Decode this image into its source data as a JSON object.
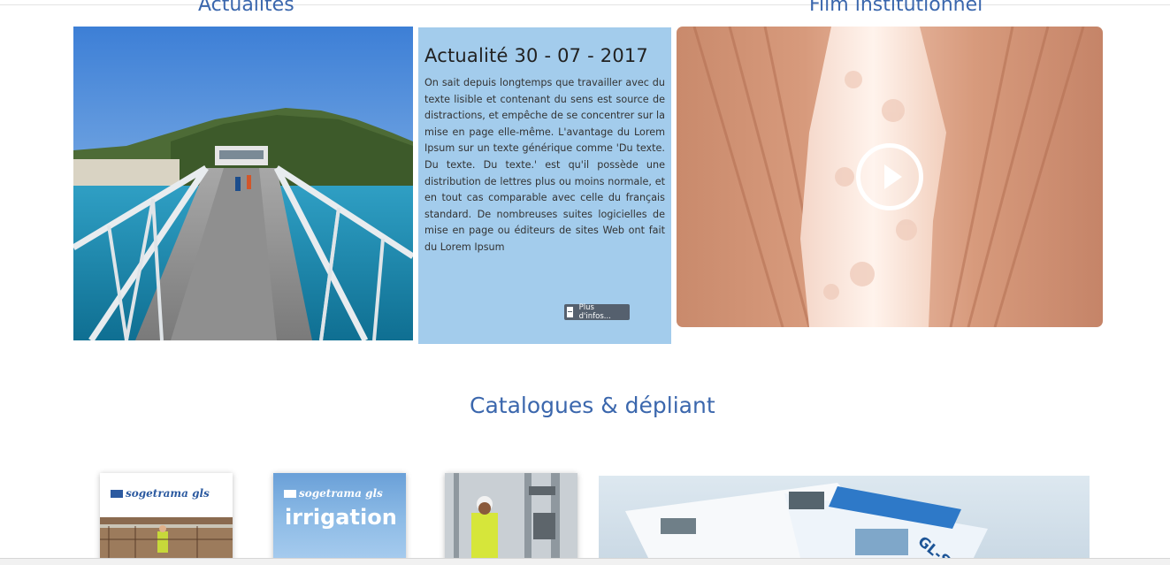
{
  "sections": {
    "actualites_title": "Actualités",
    "film_title": "Film institutionnel",
    "catalogues_title": "Catalogues & dépliant"
  },
  "news": {
    "title": "Actualité 30 - 07 - 2017",
    "body": "On sait depuis longtemps que travailler avec du texte lisible et contenant du sens est source de distractions, et empêche de se concentrer sur la mise en page elle-même. L'avantage du Lorem Ipsum sur un texte générique comme 'Du texte. Du texte. Du texte.' est qu'il possède une distribution de lettres plus ou moins normale, et en tout cas comparable avec celle du français standard. De nombreuses suites logicielles de mise en page ou éditeurs de sites Web ont fait du Lorem Ipsum",
    "more_label": "Plus d'infos..."
  },
  "catalogs": {
    "brand": "sogetrama gls",
    "irrigation": "irrigation",
    "brochure_label": "GL-SKI"
  },
  "icons": {
    "play": "play-icon",
    "more": "minus-icon",
    "logo": "sogetrama-logo-icon"
  },
  "colors": {
    "title_blue": "#3b67ad",
    "news_bg": "#a3ccec",
    "button_bg": "#55606e"
  }
}
